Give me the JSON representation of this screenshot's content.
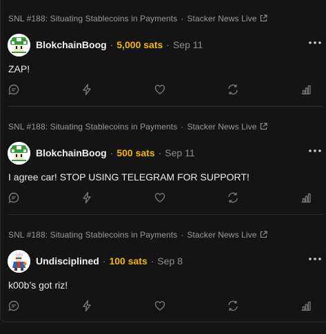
{
  "posts": [
    {
      "context_title": "SNL #188: Situating Stablecoins in Payments",
      "context_source": "Stacker News Live",
      "author": "BlokchainBoog",
      "sats": "5,000 sats",
      "date": "Sep 11",
      "body": "ZAP!",
      "avatar_icon": "green-mushroom-avatar"
    },
    {
      "context_title": "SNL #188: Situating Stablecoins in Payments",
      "context_source": "Stacker News Live",
      "author": "BlokchainBoog",
      "sats": "500 sats",
      "date": "Sep 11",
      "body": "I agree car! STOP USING TELEGRAM FOR SUPPORT!",
      "avatar_icon": "green-mushroom-avatar"
    },
    {
      "context_title": "SNL #188: Situating Stablecoins in Payments",
      "context_source": "Stacker News Live",
      "author": "Undisciplined",
      "sats": "100 sats",
      "date": "Sep 8",
      "body": "k00b’s got riz!",
      "avatar_icon": "cartoon-character-avatar"
    }
  ],
  "separator": "·",
  "colors": {
    "background": "#141414",
    "sats": "#f5b800",
    "author": "#f2f2f2",
    "muted": "#9a9a9a"
  }
}
